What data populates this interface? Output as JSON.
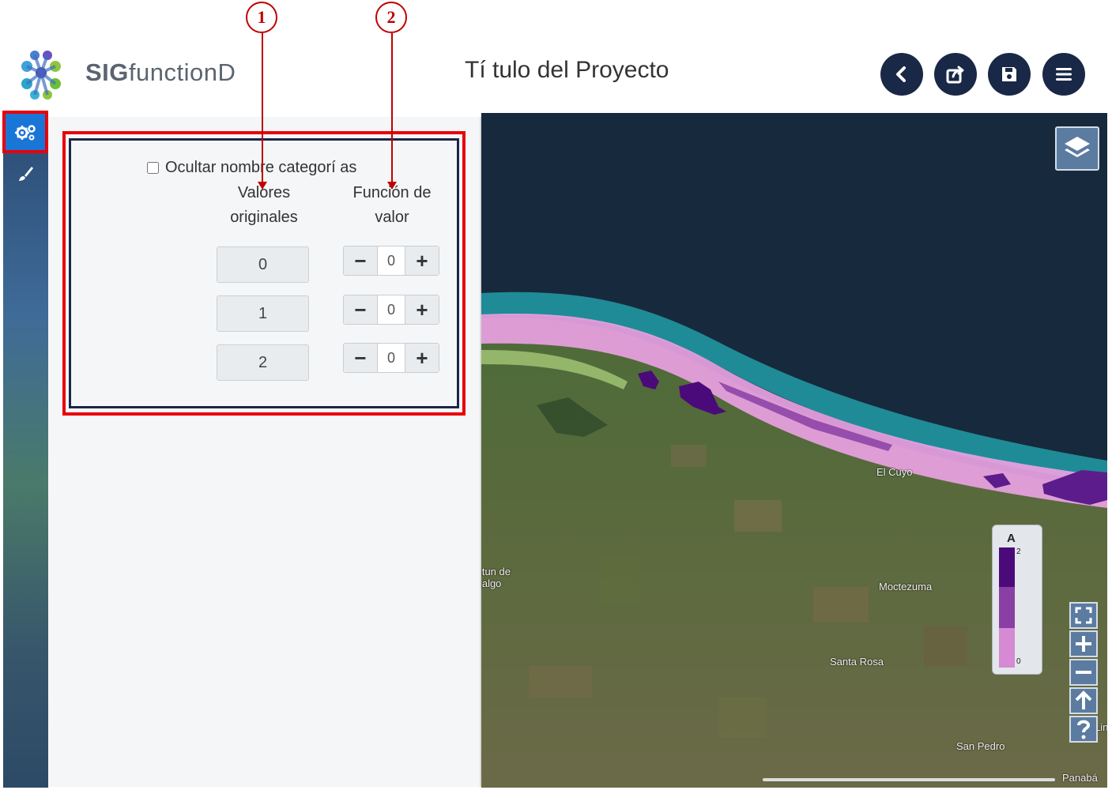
{
  "annotations": [
    {
      "number": "1"
    },
    {
      "number": "2"
    }
  ],
  "header": {
    "brand_sig": "SIG",
    "brand_rest": "functionD",
    "project_title": "Tí tulo del Proyecto",
    "buttons": [
      {
        "icon": "back-icon"
      },
      {
        "icon": "share-icon"
      },
      {
        "icon": "save-icon"
      },
      {
        "icon": "menu-icon"
      }
    ]
  },
  "rail": {
    "items": [
      {
        "icon": "gears-icon",
        "active": true
      },
      {
        "icon": "brush-icon",
        "active": false
      }
    ]
  },
  "panel": {
    "hide_categories_label": "Ocultar nombre categorí as",
    "hide_categories_checked": false,
    "col_original_line1": "Valores",
    "col_original_line2": "originales",
    "col_function_line1": "Función de",
    "col_function_line2": "valor",
    "rows": [
      {
        "original": "0",
        "value": "0"
      },
      {
        "original": "1",
        "value": "0"
      },
      {
        "original": "2",
        "value": "0"
      }
    ],
    "minus_label": "−",
    "plus_label": "+"
  },
  "map": {
    "place_labels": [
      "El Cuyo",
      "Moctezuma",
      "Santa Rosa",
      "San Pedro",
      "Panabá"
    ],
    "partial_labels": [
      "...tun de",
      "...algo",
      "Lin"
    ],
    "legend": {
      "title": "A",
      "max_label": "2",
      "min_label": "0",
      "colors": [
        "#4b0a7a",
        "#8a3fa5",
        "#d58ad3"
      ]
    },
    "controls": [
      "fullscreen-icon",
      "zoom-in-icon",
      "zoom-out-icon",
      "north-arrow-icon",
      "help-icon"
    ]
  },
  "colors": {
    "header_button": "#1a2847",
    "highlight": "#e8000b",
    "callout": "#c00000",
    "classification_light": "#e9a2e2",
    "classification_dark": "#4b0a7a"
  }
}
